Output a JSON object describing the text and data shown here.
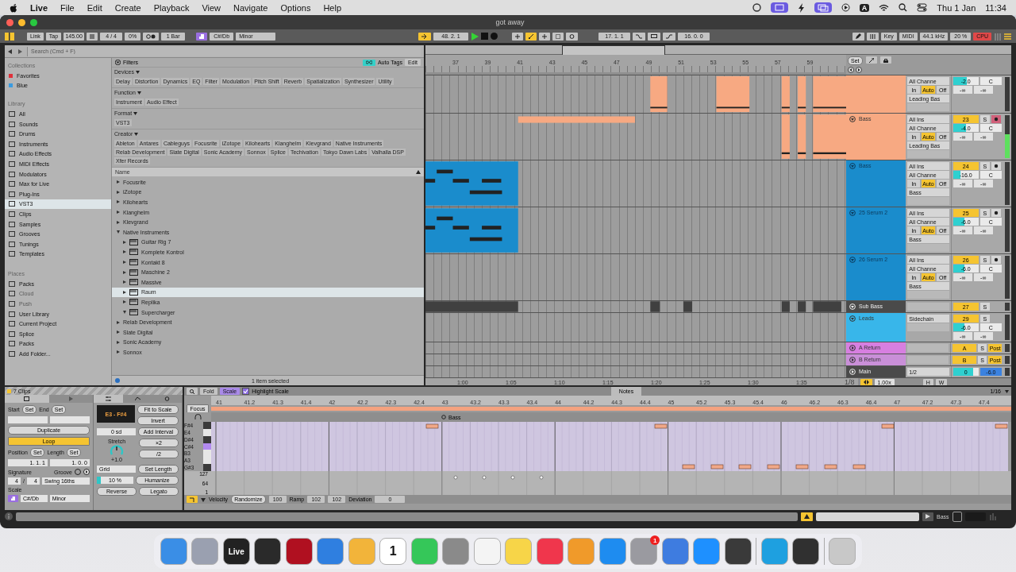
{
  "menubar": {
    "app": "Live",
    "menus": [
      "File",
      "Edit",
      "Create",
      "Playback",
      "View",
      "Navigate",
      "Options",
      "Help"
    ],
    "input_source": "A",
    "date": "Thu 1 Jan",
    "time": "11:34"
  },
  "window": {
    "title": "got away"
  },
  "control_bar": {
    "link": "Link",
    "tap": "Tap",
    "tempo": "145.00",
    "signature": "4 / 4",
    "groove": "0%",
    "quantize": "1 Bar",
    "scale_root": "C#/Db",
    "scale_mode": "Minor",
    "position": "48. 2. 1",
    "loop_start": "17. 1. 1",
    "loop_length": "16. 0. 0",
    "key": "Key",
    "midi": "MIDI",
    "sample_rate": "44.1 kHz",
    "cpu_load": "20 %",
    "cpu": "CPU"
  },
  "browser": {
    "search_placeholder": "Search (Cmd + F)",
    "collections_title": "Collections",
    "collections": [
      {
        "label": "Favorites",
        "color": "#e0303a"
      },
      {
        "label": "Blue",
        "color": "#3a9be0"
      }
    ],
    "library_title": "Library",
    "library": [
      {
        "label": "All",
        "selected": false
      },
      {
        "label": "Sounds",
        "selected": false
      },
      {
        "label": "Drums",
        "selected": false
      },
      {
        "label": "Instruments",
        "selected": false
      },
      {
        "label": "Audio Effects",
        "selected": false
      },
      {
        "label": "MIDI Effects",
        "selected": false
      },
      {
        "label": "Modulators",
        "selected": false
      },
      {
        "label": "Max for Live",
        "selected": false
      },
      {
        "label": "Plug-Ins",
        "selected": false
      },
      {
        "label": "VST3",
        "selected": true
      },
      {
        "label": "Clips",
        "selected": false
      },
      {
        "label": "Samples",
        "selected": false
      },
      {
        "label": "Grooves",
        "selected": false
      },
      {
        "label": "Tunings",
        "selected": false
      },
      {
        "label": "Templates",
        "selected": false
      }
    ],
    "places_title": "Places",
    "places": [
      {
        "label": "Packs",
        "disabled": false
      },
      {
        "label": "Cloud",
        "disabled": true
      },
      {
        "label": "Push",
        "disabled": true
      },
      {
        "label": "User Library",
        "disabled": false
      },
      {
        "label": "Current Project",
        "disabled": false
      },
      {
        "label": "Splice",
        "disabled": false
      },
      {
        "label": "Packs",
        "disabled": false
      },
      {
        "label": "Add Folder...",
        "disabled": false
      }
    ],
    "filters": {
      "title": "Filters",
      "auto_tags": "Auto Tags",
      "edit": "Edit",
      "groups": [
        {
          "title": "Devices",
          "tags": [
            {
              "label": "Delay",
              "selected": false
            },
            {
              "label": "Distortion",
              "selected": false
            },
            {
              "label": "Dynamics",
              "selected": false
            },
            {
              "label": "EQ",
              "selected": false
            },
            {
              "label": "Filter",
              "selected": false
            },
            {
              "label": "Modulation",
              "selected": false
            },
            {
              "label": "Pitch Shift",
              "selected": false
            },
            {
              "label": "Reverb",
              "selected": false
            },
            {
              "label": "Spatialization",
              "selected": false
            },
            {
              "label": "Synthesizer",
              "selected": false
            },
            {
              "label": "Utility",
              "selected": false
            }
          ]
        },
        {
          "title": "Function",
          "tags": [
            {
              "label": "Instrument",
              "selected": false
            },
            {
              "label": "Audio Effect",
              "selected": false
            }
          ]
        },
        {
          "title": "Format",
          "tags": [
            {
              "label": "VST3",
              "selected": false
            }
          ]
        },
        {
          "title": "Creator",
          "tags": [
            {
              "label": "Ableton",
              "selected": false
            },
            {
              "label": "Antares",
              "selected": false
            },
            {
              "label": "Cableguys",
              "selected": false
            },
            {
              "label": "Focusrite",
              "selected": false
            },
            {
              "label": "iZotope",
              "selected": false
            },
            {
              "label": "Kilohearts",
              "selected": false
            },
            {
              "label": "Klanghelm",
              "selected": false
            },
            {
              "label": "Klevgrand",
              "selected": false
            },
            {
              "label": "Native Instruments",
              "selected": false
            },
            {
              "label": "Relab Development",
              "selected": false
            },
            {
              "label": "Slate Digital",
              "selected": false
            },
            {
              "label": "Sonic Academy",
              "selected": false
            },
            {
              "label": "Sonnox",
              "selected": false
            },
            {
              "label": "Splice",
              "selected": false
            },
            {
              "label": "Techivation",
              "selected": false
            },
            {
              "label": "Tokyo Dawn Labs",
              "selected": false
            },
            {
              "label": "Valhalla DSP",
              "selected": false
            },
            {
              "label": "Xfer Records",
              "selected": false
            }
          ]
        }
      ]
    },
    "list_header": "Name",
    "items": [
      {
        "label": "Focusrite",
        "expanded": false,
        "selected": false
      },
      {
        "label": "iZotope",
        "expanded": false,
        "selected": false
      },
      {
        "label": "Kilohearts",
        "expanded": false,
        "selected": false
      },
      {
        "label": "Klanghelm",
        "expanded": false,
        "selected": false
      },
      {
        "label": "Klevgrand",
        "expanded": false,
        "selected": false
      },
      {
        "label": "Native Instruments",
        "expanded": true,
        "selected": false,
        "children": [
          {
            "label": "Guitar Rig 7",
            "expanded": false,
            "selected": false
          },
          {
            "label": "Komplete Kontrol",
            "expanded": false,
            "selected": false
          },
          {
            "label": "Kontakt 8",
            "expanded": false,
            "selected": false
          },
          {
            "label": "Maschine 2",
            "expanded": false,
            "selected": false
          },
          {
            "label": "Massive",
            "expanded": false,
            "selected": false
          },
          {
            "label": "Raum",
            "expanded": false,
            "selected": true
          },
          {
            "label": "Replika",
            "expanded": false,
            "selected": false
          },
          {
            "label": "Supercharger",
            "expanded": true,
            "selected": false
          }
        ]
      },
      {
        "label": "Relab Development",
        "expanded": false,
        "selected": false
      },
      {
        "label": "Slate Digital",
        "expanded": false,
        "selected": false
      },
      {
        "label": "Sonic Academy",
        "expanded": false,
        "selected": false
      },
      {
        "label": "Sonnox",
        "expanded": false,
        "selected": false
      }
    ],
    "status": "1 item selected"
  },
  "arrangement": {
    "bars": [
      "37",
      "39",
      "41",
      "43",
      "45",
      "47",
      "49",
      "51",
      "53",
      "55",
      "57",
      "59"
    ],
    "times": [
      "1:00",
      "1:05",
      "1:10",
      "1:15",
      "1:20",
      "1:25",
      "1:30",
      "1:35"
    ],
    "zoom": "1/8"
  },
  "mixer": {
    "set": "Set",
    "speed": "1.00x",
    "h": "H",
    "w": "W",
    "tracks": [
      {
        "kind": "instrument",
        "color": "#f7a982",
        "channel": "All Channe",
        "monitor": [
          {
            "label": "In",
            "selected": false
          },
          {
            "label": "Auto",
            "selected": true
          },
          {
            "label": "Off",
            "selected": false
          }
        ],
        "output": "Leading Bas",
        "volume": {
          "value": "-2.0",
          "level": 0.55
        },
        "pan": "C",
        "sends": [
          "-∞",
          "-∞"
        ]
      },
      {
        "kind": "instrument",
        "name": "Bass",
        "color": "#f7a982",
        "input": "All Ins",
        "channel": "All Channe",
        "monitor": [
          {
            "label": "In",
            "selected": false
          },
          {
            "label": "Auto",
            "selected": true
          },
          {
            "label": "Off",
            "selected": false
          }
        ],
        "output": "Leading Bas",
        "number": "23",
        "solo": "S",
        "arm": true,
        "volume": {
          "value": "-4.0",
          "level": 0.5
        },
        "pan": "C",
        "sends": [
          "-∞",
          "-∞"
        ],
        "meter": {
          "level": 0.55
        }
      },
      {
        "kind": "instrument",
        "name": "Bass",
        "color": "#1a8ccc",
        "input": "All Ins",
        "channel": "All Channe",
        "monitor": [
          {
            "label": "In",
            "selected": false
          },
          {
            "label": "Auto",
            "selected": true
          },
          {
            "label": "Off",
            "selected": false
          }
        ],
        "output": "Bass",
        "number": "24",
        "solo": "S",
        "arm": false,
        "volume": {
          "value": "-16.0",
          "level": 0.3
        },
        "pan": "C",
        "sends": [
          "-∞",
          "-∞"
        ]
      },
      {
        "kind": "instrument",
        "name": "25 Serum 2",
        "color": "#1a8ccc",
        "input": "All Ins",
        "channel": "All Channe",
        "monitor": [
          {
            "label": "In",
            "selected": false
          },
          {
            "label": "Auto",
            "selected": true
          },
          {
            "label": "Off",
            "selected": false
          }
        ],
        "output": "Bass",
        "number": "25",
        "solo": "S",
        "arm": false,
        "volume": {
          "value": "-6.0",
          "level": 0.45
        },
        "pan": "C",
        "sends": [
          "-∞",
          "-∞"
        ]
      },
      {
        "kind": "instrument",
        "name": "26 Serum 2",
        "color": "#1a8ccc",
        "input": "All Ins",
        "channel": "All Channe",
        "monitor": [
          {
            "label": "In",
            "selected": false
          },
          {
            "label": "Auto",
            "selected": true
          },
          {
            "label": "Off",
            "selected": false
          }
        ],
        "output": "Bass",
        "number": "26",
        "solo": "S",
        "arm": false,
        "volume": {
          "value": "-6.0",
          "level": 0.45
        },
        "pan": "C",
        "sends": [
          "-∞",
          "-∞"
        ]
      },
      {
        "kind": "group",
        "name": "Sub Bass",
        "color": "#4a4a4a",
        "number": "27",
        "solo": "S"
      },
      {
        "kind": "group",
        "name": "Leads",
        "color": "#38b6ea",
        "input": "Sidechain",
        "number": "29",
        "solo": "S",
        "volume": {
          "value": "-6.0",
          "level": 0.45
        },
        "pan": "C",
        "sends": [
          "-∞",
          "-∞"
        ]
      },
      {
        "kind": "return",
        "name": "A Return",
        "color": "#d77fe0",
        "number": "A",
        "solo": "S",
        "post": "Post"
      },
      {
        "kind": "return",
        "name": "B Return",
        "color": "#c98fd8",
        "number": "B",
        "solo": "S",
        "post": "Post"
      },
      {
        "kind": "main",
        "name": "Main",
        "color": "#4a4a4a",
        "output": "1/2",
        "volume": {
          "value": "0",
          "level": 0.8
        },
        "cue_volume": "-6.0"
      }
    ]
  },
  "clip": {
    "title": "7 Clips",
    "start": "Start",
    "end": "End",
    "start_set": "Set",
    "end_set": "Set",
    "position_set": "Set",
    "length_set": "Set",
    "duplicate": "Duplicate",
    "loop": {
      "label": "Loop",
      "on": true
    },
    "position_label": "Position",
    "length_label": "Length",
    "position": "1. 1. 1",
    "length": "1. 0. 0",
    "signature_label": "Signature",
    "groove_label": "Groove",
    "sig_num": "4",
    "sig_sep": "/",
    "sig_den": "4",
    "groove": "Swing 16ths",
    "scale_label": "Scale",
    "scale_root": "C#/Db",
    "scale_mode": "Minor"
  },
  "tools": {
    "range": "E3 - F#4",
    "fit": "Fit to Scale",
    "invert": "Invert",
    "interval": "0 sd",
    "add_interval": "Add Interval",
    "stretch_label": "Stretch",
    "stretch_value": "+1.0",
    "double": "×2",
    "half": "/2",
    "grid": "Grid",
    "set_length": "Set Length",
    "humanize_value": "10 %",
    "humanize_amount": {
      "level": 0.1
    },
    "humanize": "Humanize",
    "reverse": "Reverse",
    "legato": "Legato"
  },
  "editor": {
    "fold": "Fold",
    "scale": {
      "label": "Scale",
      "selected": true
    },
    "highlight": {
      "label": "Highlight Scale",
      "checked": true
    },
    "tab": "Notes",
    "grid": "1/16",
    "ruler": [
      "41",
      "41.2",
      "41.3",
      "41.4",
      "42",
      "42.2",
      "42.3",
      "42.4",
      "43",
      "43.2",
      "43.3",
      "43.4",
      "44",
      "44.2",
      "44.3",
      "44.4",
      "45",
      "45.2",
      "45.3",
      "45.4",
      "46",
      "46.2",
      "46.3",
      "46.4",
      "47",
      "47.2",
      "47.3",
      "47.4"
    ],
    "focus": "Focus",
    "clip_name": "Bass",
    "keys": [
      {
        "label": "F#4",
        "kind": "black"
      },
      {
        "label": "E4",
        "kind": "white"
      },
      {
        "label": "D#4",
        "kind": "black"
      },
      {
        "label": "C#4",
        "kind": "root"
      },
      {
        "label": "B3",
        "kind": "white"
      },
      {
        "label": "A3",
        "kind": "white"
      },
      {
        "label": "G#3",
        "kind": "black"
      }
    ],
    "velocity_ticks": [
      "127",
      "64",
      "1"
    ],
    "velocity_label": "Velocity",
    "randomize": "Randomize",
    "velocity": "100",
    "ramp_label": "Ramp",
    "ramp_from": "102",
    "ramp_to": "102",
    "deviation_label": "Deviation",
    "deviation": "0"
  },
  "status_bar": {
    "track": "Bass"
  },
  "dock": [
    {
      "color": "#3a8ee6"
    },
    {
      "color": "#9aa0b0"
    },
    {
      "color": "#222222",
      "label": "Live"
    },
    {
      "color": "#2a2a2a"
    },
    {
      "color": "#b01020"
    },
    {
      "color": "#2f7fe0"
    },
    {
      "color": "#f2b43a"
    },
    {
      "color": "#ffffff",
      "label": "1"
    },
    {
      "color": "#35c759"
    },
    {
      "color": "#8a8a8a"
    },
    {
      "color": "#f4f4f4"
    },
    {
      "color": "#f7d548"
    },
    {
      "color": "#f0364c"
    },
    {
      "color": "#f09a2a"
    },
    {
      "color": "#1e8cf0"
    },
    {
      "color": "#9a9aa0",
      "badge": "1"
    },
    {
      "color": "#3e7ce0"
    },
    {
      "color": "#1e90ff"
    },
    {
      "color": "#3a3a3a"
    },
    {
      "color": "#1ea0e0"
    },
    {
      "color": "#303030"
    },
    {
      "color": "#c8c8c8"
    }
  ]
}
